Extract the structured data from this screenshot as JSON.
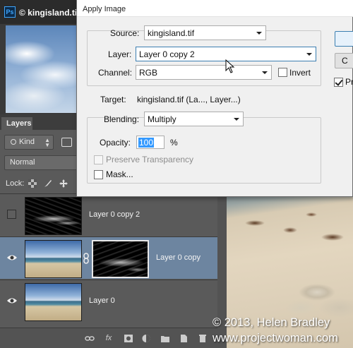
{
  "document": {
    "tab_title": "© kingisland.tif",
    "app_badge": "Ps"
  },
  "layers_panel": {
    "tab_label": "Layers",
    "kind_filter": "Kind",
    "blend_mode": "Normal",
    "lock_label": "Lock:",
    "layers": [
      {
        "name": "Layer 0 copy 2",
        "visible": false,
        "selected": false,
        "has_mask": false
      },
      {
        "name": "Layer 0 copy",
        "visible": true,
        "selected": true,
        "has_mask": true
      },
      {
        "name": "Layer 0",
        "visible": true,
        "selected": false,
        "has_mask": false
      }
    ],
    "footer_icons": [
      "link-icon",
      "fx-icon",
      "add-mask-icon",
      "adjustment-icon",
      "folder-icon",
      "new-layer-icon",
      "trash-icon"
    ],
    "fx_label": "fx"
  },
  "dialog": {
    "title": "Apply Image",
    "source_label": "Source:",
    "source_value": "kingisland.tif",
    "layer_label": "Layer:",
    "layer_value": "Layer 0 copy 2",
    "channel_label": "Channel:",
    "channel_value": "RGB",
    "invert_label": "Invert",
    "invert_checked": false,
    "target_label": "Target:",
    "target_value": "kingisland.tif (La..., Layer...)",
    "blending_label": "Blending:",
    "blending_value": "Multiply",
    "opacity_label": "Opacity:",
    "opacity_value": "100",
    "opacity_unit": "%",
    "preserve_transparency_label": "Preserve Transparency",
    "mask_label": "Mask...",
    "cancel_label_visible": "C",
    "preview_label_visible": "Pr",
    "preview_checked": true
  },
  "watermark": {
    "line1": "© 2013, Helen Bradley",
    "line2": "www.projectwoman.com"
  },
  "colors": {
    "panel_bg": "#5a5a5a",
    "selected_layer": "#6d85a0",
    "dialog_bg": "#f0f0f0",
    "selection_highlight": "#3399ff"
  }
}
